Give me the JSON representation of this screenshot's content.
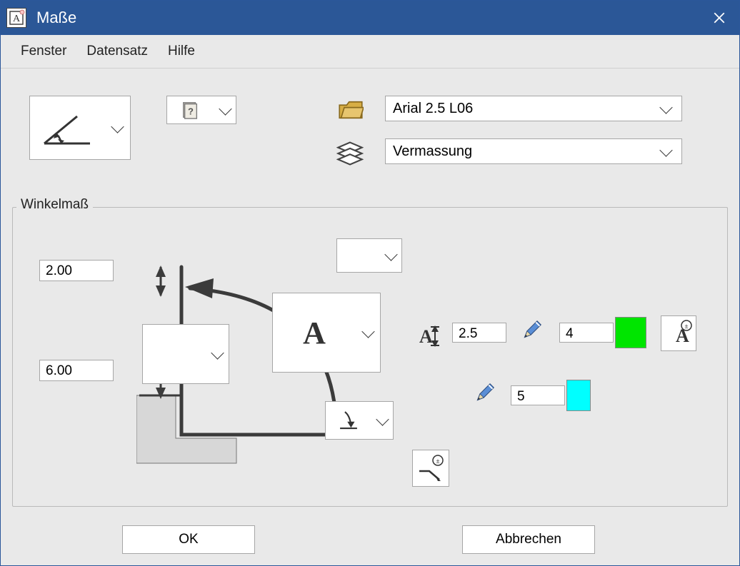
{
  "window": {
    "title": "Maße"
  },
  "menubar": {
    "fenster": "Fenster",
    "datensatz": "Datensatz",
    "hilfe": "Hilfe"
  },
  "top": {
    "font_select": "Arial 2.5 L06",
    "layer_select": "Vermassung"
  },
  "section": {
    "label": "Winkelmaß"
  },
  "fields": {
    "offset_a": "2.00",
    "offset_b": "6.00",
    "text_height": "2.5",
    "pen1": "4",
    "pen2": "5"
  },
  "buttons": {
    "ok": "OK",
    "cancel": "Abbrechen"
  },
  "colors": {
    "pen1_swatch": "#00e500",
    "pen2_swatch": "#00ffff"
  }
}
